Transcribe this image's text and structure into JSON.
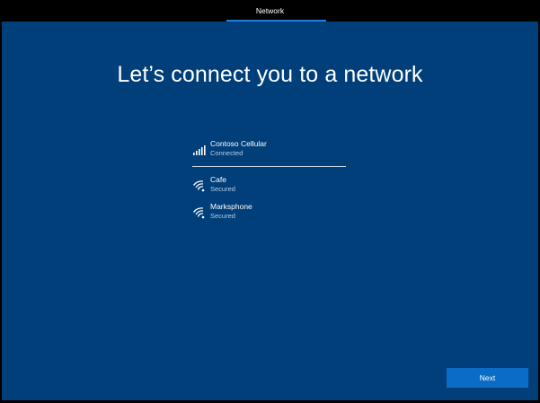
{
  "window": {
    "title": "Network"
  },
  "main": {
    "heading": "Let’s connect you to a network"
  },
  "networks": [
    {
      "name": "Contoso Cellular",
      "status": "Connected",
      "icon": "cellular-signal-icon"
    },
    {
      "name": "Cafe",
      "status": "Secured",
      "icon": "wifi-icon"
    },
    {
      "name": "Marksphone",
      "status": "Secured",
      "icon": "wifi-icon"
    }
  ],
  "footer": {
    "next_label": "Next"
  },
  "colors": {
    "background": "#003f7a",
    "accent": "#0a6cc7",
    "tab_underline": "#1f7fd6",
    "text": "#ffffff",
    "secondary_text": "#b9cde3"
  }
}
